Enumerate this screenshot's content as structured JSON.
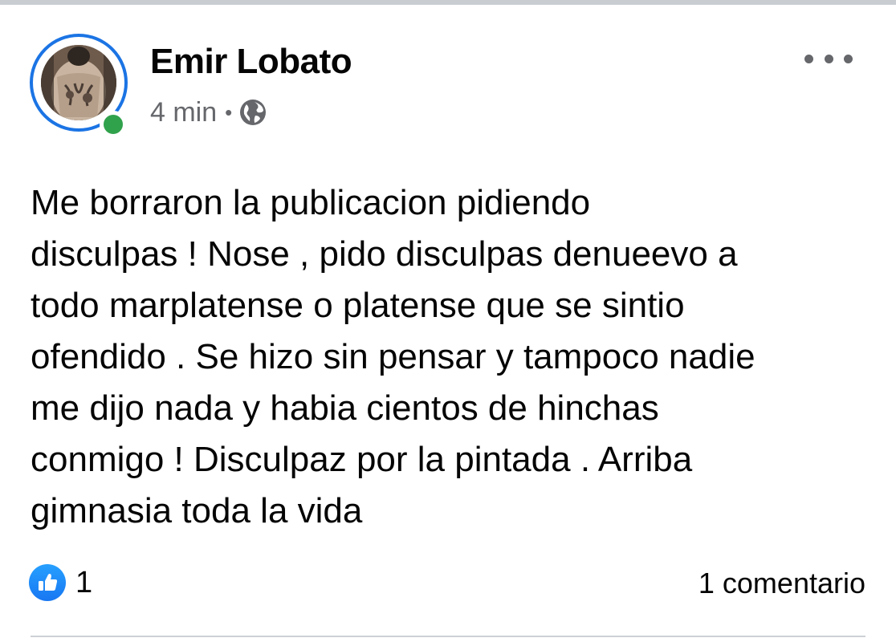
{
  "post": {
    "author_name": "Emir Lobato",
    "time_ago": "4 min",
    "separator": "•",
    "audience_icon": "globe-icon",
    "avatar_icon": "avatar",
    "online_status": "online",
    "more_icon": "more-dots-icon",
    "text_lines": [
      "Me borraron la publicacion pidiendo",
      "disculpas ! Nose , pido disculpas denueevo a",
      "todo marplatense o platense que se sintio",
      "ofendido . Se hizo sin pensar y tampoco nadie",
      "me dijo nada y habia cientos de hinchas",
      "conmigo ! Disculpaz por la pintada . Arriba",
      "gimnasia toda la vida"
    ],
    "reaction_icon": "like-icon",
    "reaction_count": "1",
    "comments_label": "1 comentario"
  },
  "colors": {
    "accent": "#1b74e4",
    "online": "#31a24c",
    "secondary_text": "#65676b",
    "primary_text": "#050505",
    "like_blue": "#1877f2"
  }
}
